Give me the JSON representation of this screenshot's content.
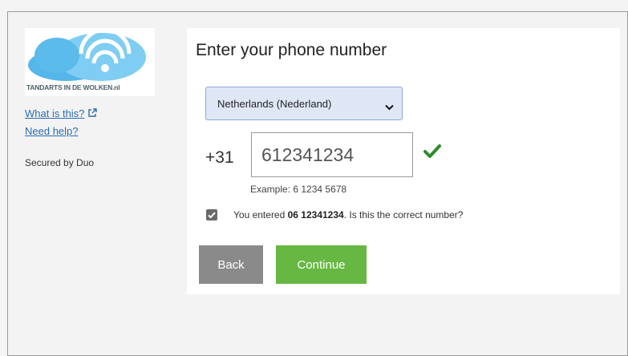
{
  "logo": {
    "text": "TANDARTS IN DE WOLKEN.nl"
  },
  "sidebar": {
    "what_is_this": "What is this?",
    "need_help": "Need help?",
    "secured_by": "Secured by Duo"
  },
  "main": {
    "title": "Enter your phone number",
    "country_select_value": "Netherlands (Nederland)",
    "country_prefix": "+31",
    "phone_value": "612341234",
    "example": "Example: 6 1234 5678",
    "confirm_prefix": "You entered ",
    "confirm_number": "06 12341234",
    "confirm_suffix": ". Is this the correct number?",
    "back_label": "Back",
    "continue_label": "Continue"
  },
  "colors": {
    "link": "#2b6cb0",
    "continue": "#67b843",
    "back": "#8a8a8a",
    "check": "#2e8b2e"
  }
}
